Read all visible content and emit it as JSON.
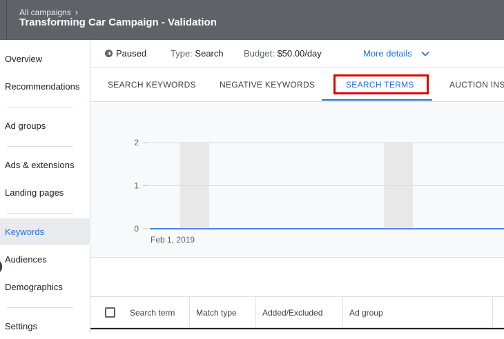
{
  "header": {
    "breadcrumb": "All campaigns",
    "campaign_title": "Transforming Car Campaign - Validation"
  },
  "sidebar": {
    "items": [
      {
        "label": "Overview"
      },
      {
        "label": "Recommendations"
      },
      {
        "label": "Ad groups"
      },
      {
        "label": "Ads & extensions"
      },
      {
        "label": "Landing pages"
      },
      {
        "label": "Keywords",
        "active": true
      },
      {
        "label": "Audiences"
      },
      {
        "label": "Demographics"
      },
      {
        "label": "Settings"
      }
    ]
  },
  "status": {
    "state": "Paused",
    "type_label": "Type:",
    "type_value": "Search",
    "budget_label": "Budget:",
    "budget_value": "$50.00/day",
    "more_details": "More details"
  },
  "tabs": [
    {
      "label": "SEARCH KEYWORDS"
    },
    {
      "label": "NEGATIVE KEYWORDS"
    },
    {
      "label": "SEARCH TERMS",
      "active": true
    },
    {
      "label": "AUCTION INSI"
    }
  ],
  "chart_data": {
    "type": "line",
    "x": [
      "Feb 1, 2019"
    ],
    "series": [
      {
        "values": [
          0
        ]
      }
    ],
    "yticks": [
      0,
      1,
      2
    ],
    "ylim": [
      0,
      2
    ],
    "x_tick_label": "Feb 1, 2019",
    "grid": true,
    "colors": {
      "line": "#4285f4",
      "weekend_band": "#e8e8e8"
    }
  },
  "table": {
    "columns": [
      "Search term",
      "Match type",
      "Added/Excluded",
      "Ad group"
    ]
  },
  "colors": {
    "accent": "#1a73e8",
    "header_bg": "#5f6368",
    "highlight": "#e00000"
  }
}
